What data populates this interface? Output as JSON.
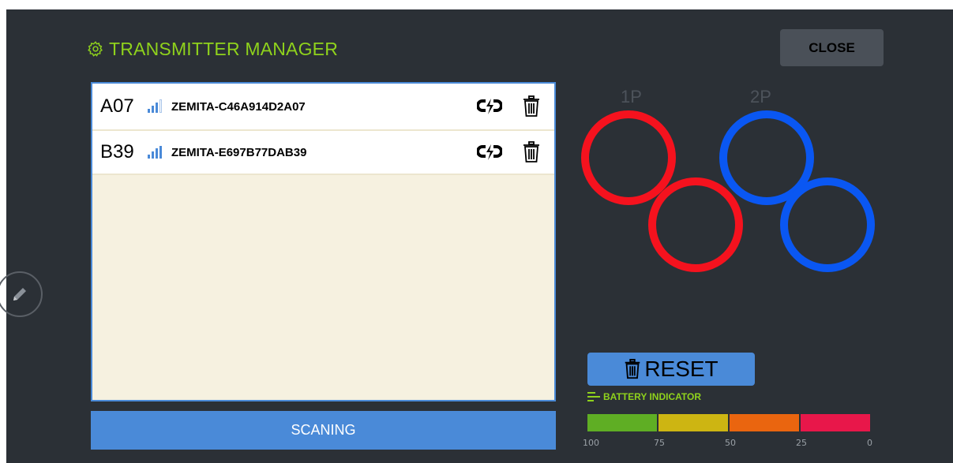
{
  "header": {
    "title": "TRANSMITTER MANAGER",
    "close_label": "CLOSE"
  },
  "transmitters": [
    {
      "code": "A07",
      "name": "ZEMITA-C46A914D2A07",
      "signal_bars": 3
    },
    {
      "code": "B39",
      "name": "ZEMITA-E697B77DAB39",
      "signal_bars": 4
    }
  ],
  "scan_label": "SCANING",
  "players": {
    "p1_label": "1P",
    "p2_label": "2P",
    "p1_color": "#f5121e",
    "p2_color": "#0a57f2"
  },
  "reset_label": "RESET",
  "battery": {
    "title": "BATTERY INDICATOR",
    "levels": [
      "100",
      "75",
      "50",
      "25",
      "0"
    ],
    "colors": [
      "#5fae24",
      "#cdb512",
      "#ea650f",
      "#e8174a"
    ]
  },
  "colors": {
    "accent": "#8fd21c",
    "primary": "#4a8ad8"
  }
}
